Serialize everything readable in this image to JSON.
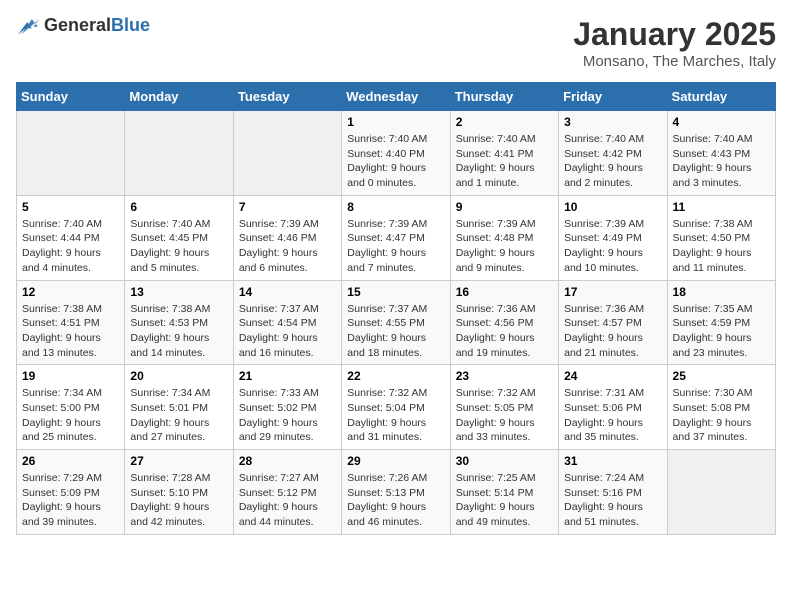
{
  "logo": {
    "general": "General",
    "blue": "Blue"
  },
  "header": {
    "month": "January 2025",
    "location": "Monsano, The Marches, Italy"
  },
  "weekdays": [
    "Sunday",
    "Monday",
    "Tuesday",
    "Wednesday",
    "Thursday",
    "Friday",
    "Saturday"
  ],
  "weeks": [
    [
      {
        "day": "",
        "info": ""
      },
      {
        "day": "",
        "info": ""
      },
      {
        "day": "",
        "info": ""
      },
      {
        "day": "1",
        "info": "Sunrise: 7:40 AM\nSunset: 4:40 PM\nDaylight: 9 hours\nand 0 minutes."
      },
      {
        "day": "2",
        "info": "Sunrise: 7:40 AM\nSunset: 4:41 PM\nDaylight: 9 hours\nand 1 minute."
      },
      {
        "day": "3",
        "info": "Sunrise: 7:40 AM\nSunset: 4:42 PM\nDaylight: 9 hours\nand 2 minutes."
      },
      {
        "day": "4",
        "info": "Sunrise: 7:40 AM\nSunset: 4:43 PM\nDaylight: 9 hours\nand 3 minutes."
      }
    ],
    [
      {
        "day": "5",
        "info": "Sunrise: 7:40 AM\nSunset: 4:44 PM\nDaylight: 9 hours\nand 4 minutes."
      },
      {
        "day": "6",
        "info": "Sunrise: 7:40 AM\nSunset: 4:45 PM\nDaylight: 9 hours\nand 5 minutes."
      },
      {
        "day": "7",
        "info": "Sunrise: 7:39 AM\nSunset: 4:46 PM\nDaylight: 9 hours\nand 6 minutes."
      },
      {
        "day": "8",
        "info": "Sunrise: 7:39 AM\nSunset: 4:47 PM\nDaylight: 9 hours\nand 7 minutes."
      },
      {
        "day": "9",
        "info": "Sunrise: 7:39 AM\nSunset: 4:48 PM\nDaylight: 9 hours\nand 9 minutes."
      },
      {
        "day": "10",
        "info": "Sunrise: 7:39 AM\nSunset: 4:49 PM\nDaylight: 9 hours\nand 10 minutes."
      },
      {
        "day": "11",
        "info": "Sunrise: 7:38 AM\nSunset: 4:50 PM\nDaylight: 9 hours\nand 11 minutes."
      }
    ],
    [
      {
        "day": "12",
        "info": "Sunrise: 7:38 AM\nSunset: 4:51 PM\nDaylight: 9 hours\nand 13 minutes."
      },
      {
        "day": "13",
        "info": "Sunrise: 7:38 AM\nSunset: 4:53 PM\nDaylight: 9 hours\nand 14 minutes."
      },
      {
        "day": "14",
        "info": "Sunrise: 7:37 AM\nSunset: 4:54 PM\nDaylight: 9 hours\nand 16 minutes."
      },
      {
        "day": "15",
        "info": "Sunrise: 7:37 AM\nSunset: 4:55 PM\nDaylight: 9 hours\nand 18 minutes."
      },
      {
        "day": "16",
        "info": "Sunrise: 7:36 AM\nSunset: 4:56 PM\nDaylight: 9 hours\nand 19 minutes."
      },
      {
        "day": "17",
        "info": "Sunrise: 7:36 AM\nSunset: 4:57 PM\nDaylight: 9 hours\nand 21 minutes."
      },
      {
        "day": "18",
        "info": "Sunrise: 7:35 AM\nSunset: 4:59 PM\nDaylight: 9 hours\nand 23 minutes."
      }
    ],
    [
      {
        "day": "19",
        "info": "Sunrise: 7:34 AM\nSunset: 5:00 PM\nDaylight: 9 hours\nand 25 minutes."
      },
      {
        "day": "20",
        "info": "Sunrise: 7:34 AM\nSunset: 5:01 PM\nDaylight: 9 hours\nand 27 minutes."
      },
      {
        "day": "21",
        "info": "Sunrise: 7:33 AM\nSunset: 5:02 PM\nDaylight: 9 hours\nand 29 minutes."
      },
      {
        "day": "22",
        "info": "Sunrise: 7:32 AM\nSunset: 5:04 PM\nDaylight: 9 hours\nand 31 minutes."
      },
      {
        "day": "23",
        "info": "Sunrise: 7:32 AM\nSunset: 5:05 PM\nDaylight: 9 hours\nand 33 minutes."
      },
      {
        "day": "24",
        "info": "Sunrise: 7:31 AM\nSunset: 5:06 PM\nDaylight: 9 hours\nand 35 minutes."
      },
      {
        "day": "25",
        "info": "Sunrise: 7:30 AM\nSunset: 5:08 PM\nDaylight: 9 hours\nand 37 minutes."
      }
    ],
    [
      {
        "day": "26",
        "info": "Sunrise: 7:29 AM\nSunset: 5:09 PM\nDaylight: 9 hours\nand 39 minutes."
      },
      {
        "day": "27",
        "info": "Sunrise: 7:28 AM\nSunset: 5:10 PM\nDaylight: 9 hours\nand 42 minutes."
      },
      {
        "day": "28",
        "info": "Sunrise: 7:27 AM\nSunset: 5:12 PM\nDaylight: 9 hours\nand 44 minutes."
      },
      {
        "day": "29",
        "info": "Sunrise: 7:26 AM\nSunset: 5:13 PM\nDaylight: 9 hours\nand 46 minutes."
      },
      {
        "day": "30",
        "info": "Sunrise: 7:25 AM\nSunset: 5:14 PM\nDaylight: 9 hours\nand 49 minutes."
      },
      {
        "day": "31",
        "info": "Sunrise: 7:24 AM\nSunset: 5:16 PM\nDaylight: 9 hours\nand 51 minutes."
      },
      {
        "day": "",
        "info": ""
      }
    ]
  ]
}
